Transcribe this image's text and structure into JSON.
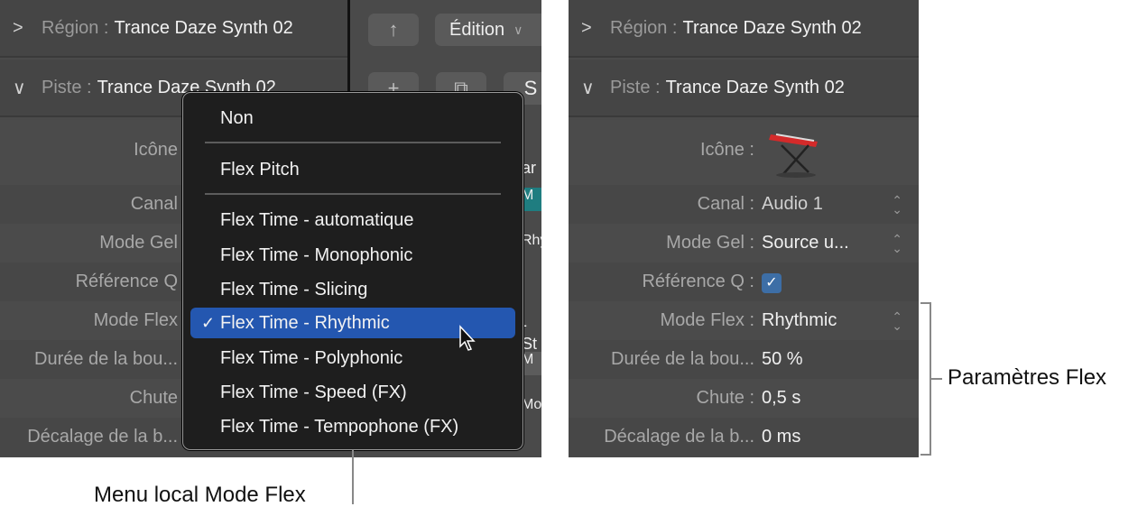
{
  "left": {
    "region": {
      "key": "Région :",
      "value": "Trance Daze Synth 02"
    },
    "track": {
      "key": "Piste :",
      "value": "Trance Daze Synth 02"
    },
    "toolbar": {
      "edit_label": "Édition",
      "s_label": "S"
    },
    "rows": [
      "Icône",
      "Canal",
      "Mode Gel",
      "Référence Q",
      "Mode Flex",
      "Durée de la bou...",
      "Chute",
      "Décalage de la b..."
    ],
    "peek": [
      "ar",
      "M",
      "Rhy",
      "-St",
      "M",
      "Mo"
    ]
  },
  "menu": {
    "items": [
      "Non",
      "Flex Pitch",
      "Flex Time - automatique",
      "Flex Time - Monophonic",
      "Flex Time - Slicing",
      "Flex Time - Rhythmic",
      "Flex Time - Polyphonic",
      "Flex Time - Speed (FX)",
      "Flex Time - Tempophone (FX)"
    ],
    "selected": "Flex Time - Rhythmic",
    "check": "✓"
  },
  "right": {
    "region": {
      "key": "Région :",
      "value": "Trance Daze Synth 02"
    },
    "track": {
      "key": "Piste :",
      "value": "Trance Daze Synth 02"
    },
    "rows": [
      {
        "label": "Icône  :",
        "value": ""
      },
      {
        "label": "Canal :",
        "value": "Audio 1"
      },
      {
        "label": "Mode Gel  :",
        "value": "Source u..."
      },
      {
        "label": "Référence Q :",
        "value": "✓"
      },
      {
        "label": "Mode Flex :",
        "value": "Rhythmic"
      },
      {
        "label": "Durée de la bou...",
        "value": "50 %"
      },
      {
        "label": "Chute :",
        "value": "0,5 s"
      },
      {
        "label": "Décalage de la b...",
        "value": "0 ms"
      }
    ]
  },
  "callouts": {
    "menu": "Menu local Mode Flex",
    "params": "Paramètres Flex"
  },
  "icons": {
    "collapsed": "›",
    "expanded": "⌄",
    "stepper": "⌃⌄",
    "up": "↑",
    "plus": "+",
    "chevron": "⌄"
  }
}
